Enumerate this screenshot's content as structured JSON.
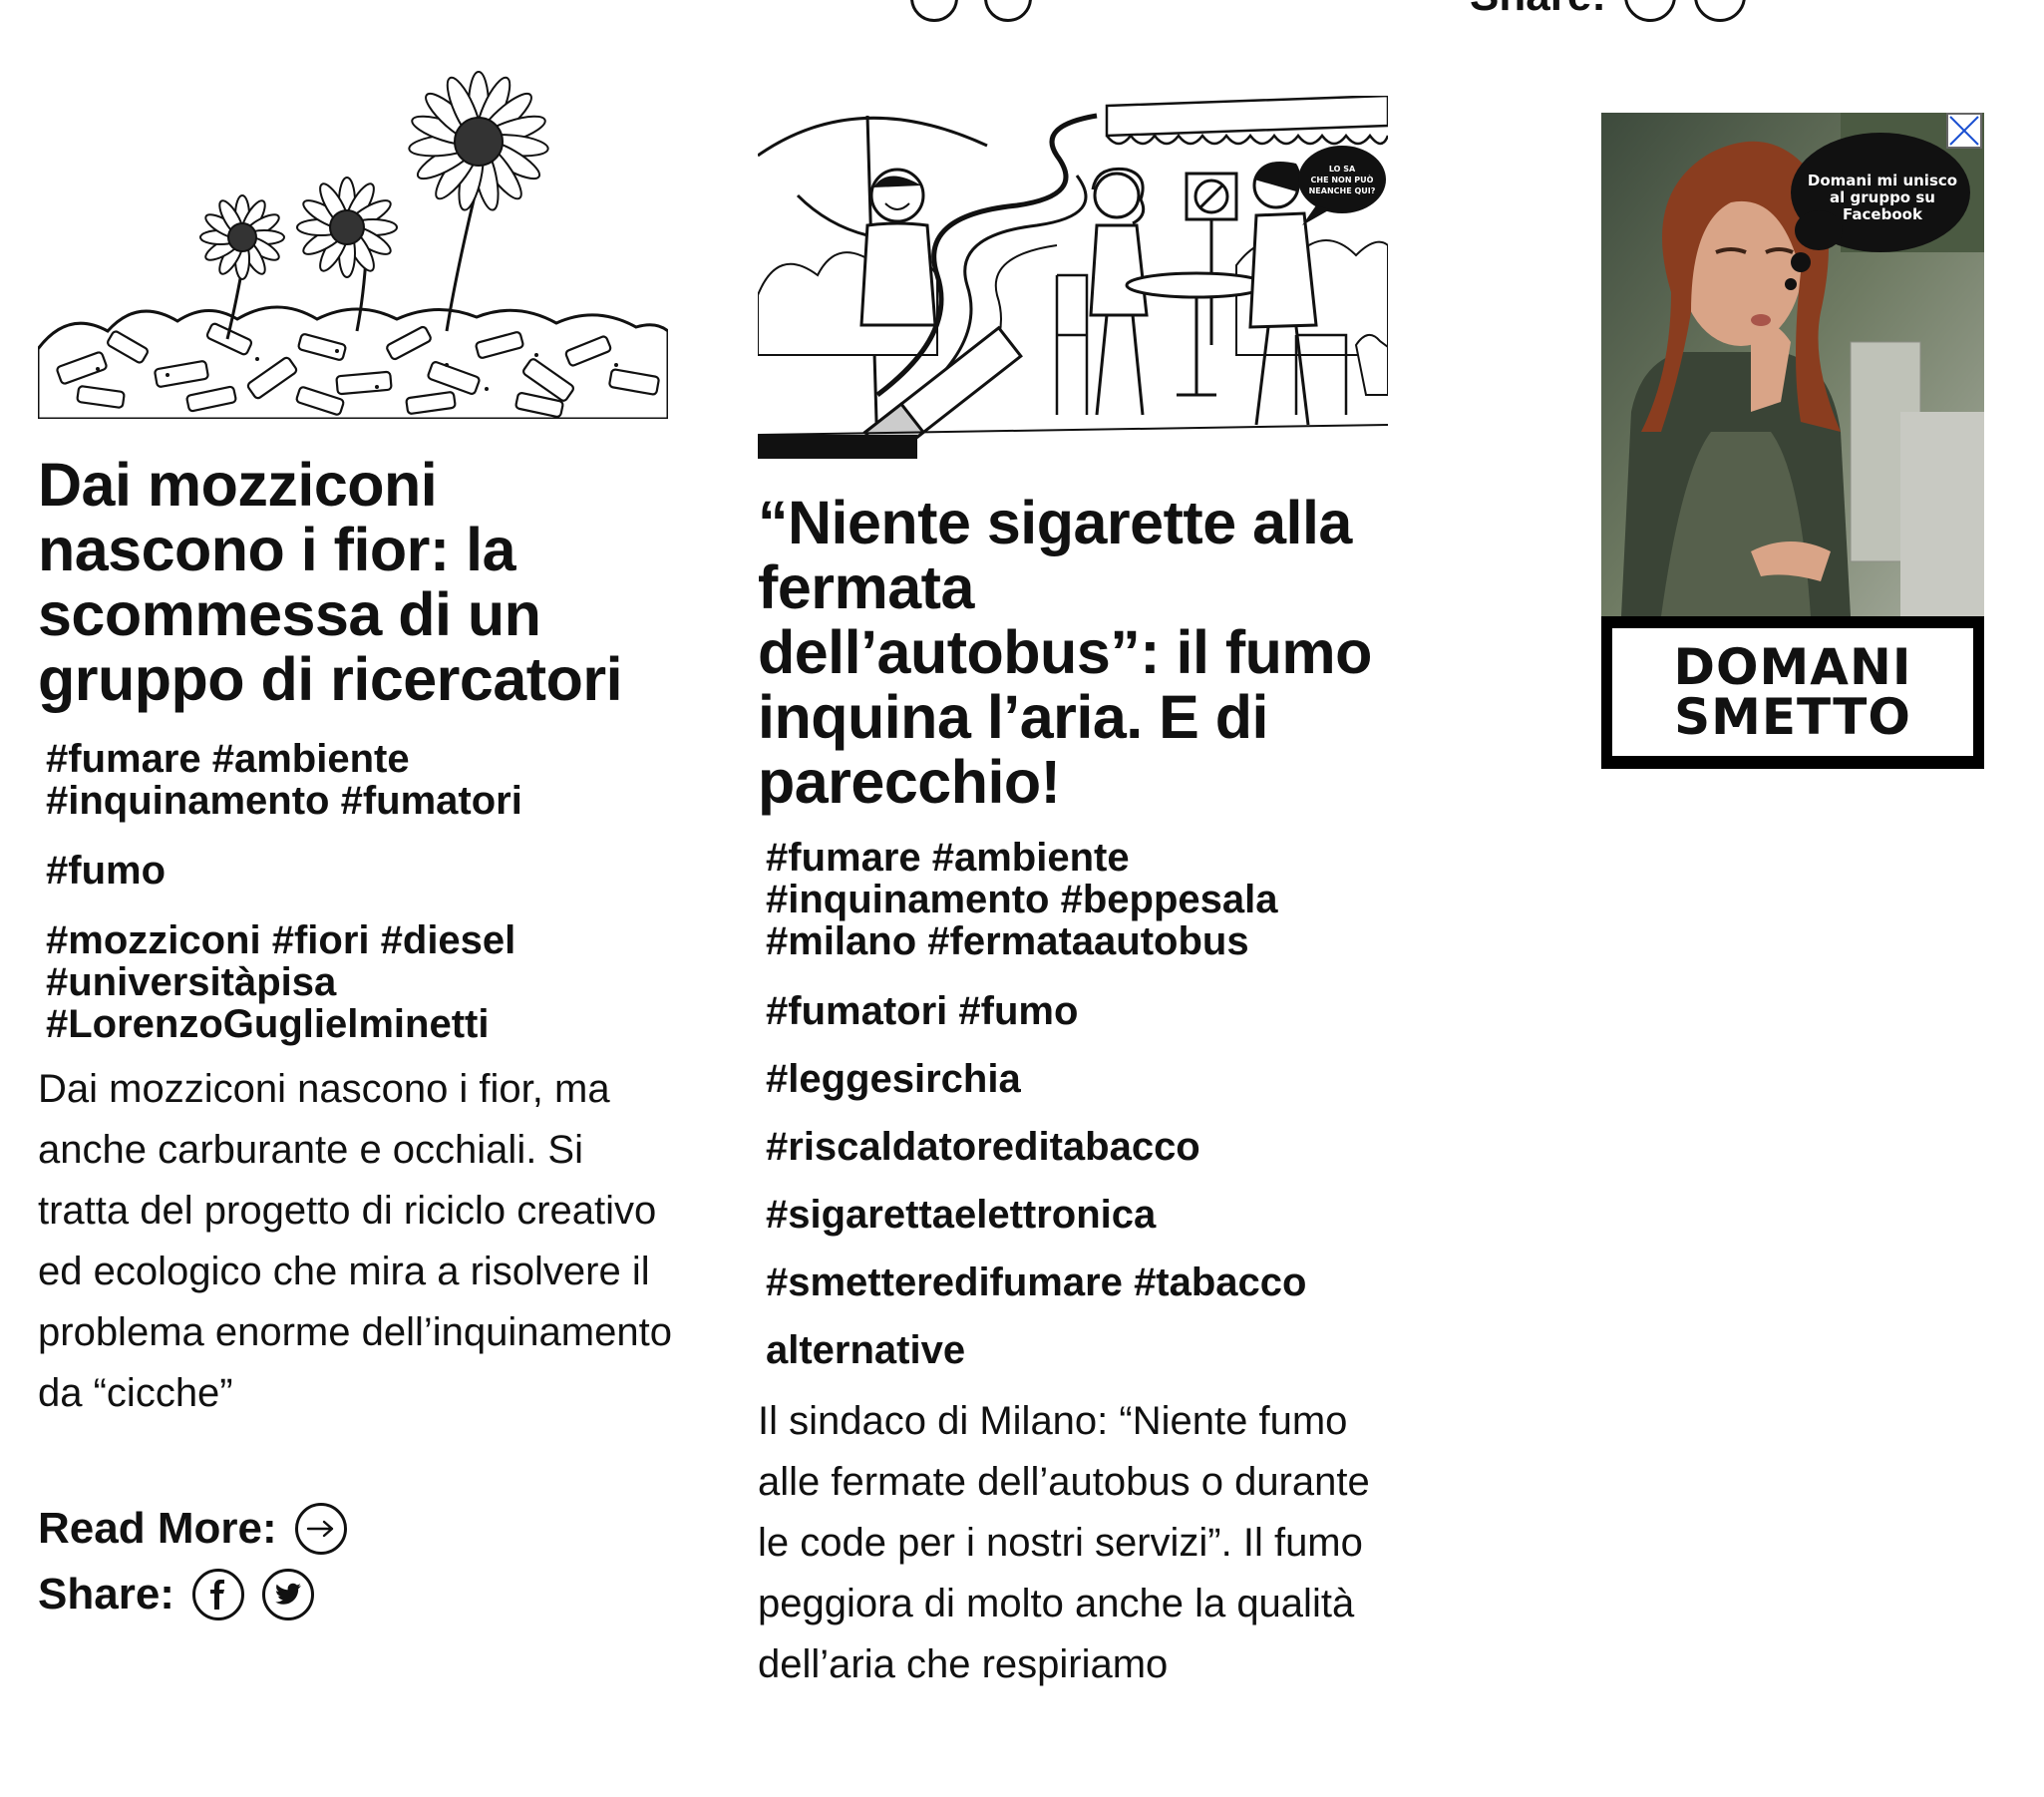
{
  "top": {
    "share_label": "Share:",
    "share_icons": [
      "facebook-icon",
      "twitter-icon"
    ]
  },
  "articles": [
    {
      "image_alt": "cigarette-butts-with-daisies-illustration",
      "title": "Dai mozziconi nascono i fior: la scommessa di un gruppo di ricercatori",
      "tag_groups": [
        [
          "#fumare",
          "#ambiente",
          "#inquinamento",
          "#fumatori"
        ],
        [
          "#fumo"
        ],
        [
          "#mozziconi",
          "#fiori",
          "#diesel",
          "#universitàpisa",
          "#LorenzoGuglielminetti"
        ]
      ],
      "excerpt": "Dai mozziconi nascono i fior, ma anche carburante e occhiali. Si tratta del progetto di riciclo creativo ed ecologico che mira a risolvere il problema enorme dell’inquinamento da “cicche”",
      "read_more_label": "Read More:",
      "share_label": "Share:"
    },
    {
      "image_alt": "cafe-smoking-illustration",
      "image_bubble_text": "LO SA CHE NON PUÒ NEANCHE QUI?",
      "title": "“Niente sigarette alla fermata dell’autobus”: il fumo inquina l’aria. E di parecchio!",
      "tag_groups": [
        [
          "#fumare",
          "#ambiente",
          "#inquinamento",
          "#beppesala",
          "#milano",
          "#fermataautobus"
        ],
        [
          "#fumatori",
          "#fumo"
        ],
        [
          "#leggesirchia"
        ],
        [
          "#riscaldatoreditabacco"
        ],
        [
          "#sigarettaelettronica"
        ],
        [
          "#smetteredifumare",
          "#tabacco"
        ],
        [
          "alternative"
        ]
      ],
      "excerpt": "Il sindaco di Milano: “Niente fumo alle fermate dell’autobus o durante le code per i nostri servizi”. Il fumo peggiora di molto anche la qualità dell’aria che respiriamo"
    }
  ],
  "ad": {
    "bubble_text": "Domani mi unisco al gruppo su Facebook",
    "logo_line1": "DOMANI",
    "logo_line2": "SMETTO",
    "close_icon": "close-icon"
  }
}
